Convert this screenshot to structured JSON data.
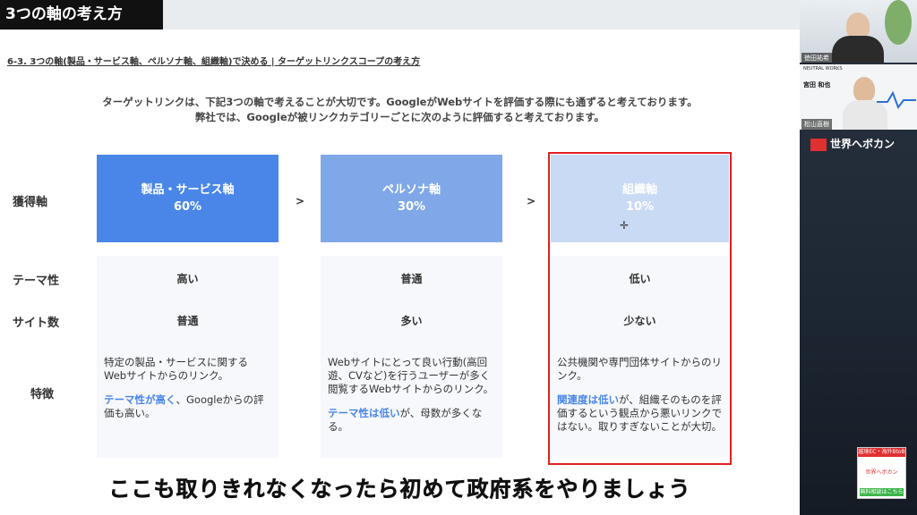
{
  "slide": {
    "title": "3つの軸の考え方",
    "breadcrumb": "6-3. 3つの軸(製品・サービス軸、ペルソナ軸、組織軸)で決める | ターゲットリンクスコープの考え方",
    "intro_line1": "ターゲットリンクは、下記3つの軸で考えることが大切です。GoogleがWebサイトを評価する際にも通ずると考えております。",
    "intro_line2": "弊社では、Googleが被リンクカテゴリーごとに次のように評価すると考えております。",
    "row_labels": [
      "獲得軸",
      "テーマ性",
      "サイト数",
      "特徴"
    ],
    "separator": ">",
    "columns": [
      {
        "name": "製品・サービス軸",
        "percent": "60%",
        "theme": "高い",
        "sites": "普通",
        "desc1": "特定の製品・サービスに関するWebサイトからのリンク。",
        "desc2_hl": "テーマ性が高く",
        "desc2_rest": "、Googleからの評価も高い。",
        "color": "#4a86e8"
      },
      {
        "name": "ペルソナ軸",
        "percent": "30%",
        "theme": "普通",
        "sites": "多い",
        "desc1": "Webサイトにとって良い行動(高回遊、CVなど)を行うユーザーが多く閲覧するWebサイトからのリンク。",
        "desc2_hl": "テーマ性は低い",
        "desc2_rest": "が、母数が多くなる。",
        "color": "#80a8e8"
      },
      {
        "name": "組織軸",
        "percent": "10%",
        "theme": "低い",
        "sites": "少ない",
        "desc1": "公共機関や専門団体サイトからのリンク。",
        "desc2_hl": "関連度は低い",
        "desc2_rest": "が、組織そのものを評価するという観点から悪いリンクではない。取りすぎないことが大切。",
        "color": "#c9daf5"
      }
    ]
  },
  "caption": "ここも取りきれなくなったら初めて政府系をやりましょう",
  "sidebar": {
    "cam1_name": "徳田祐希",
    "cam2_name": "松山直樹",
    "cam2_card_company": "NEUTRAL WORKS",
    "cam2_card_name": "宮田 和也",
    "brand": "世界へボカン",
    "badge_top": "越境EC・海外BtoB",
    "badge_brand": "世界へボカン",
    "badge_bottom": "無料相談はこちら"
  }
}
